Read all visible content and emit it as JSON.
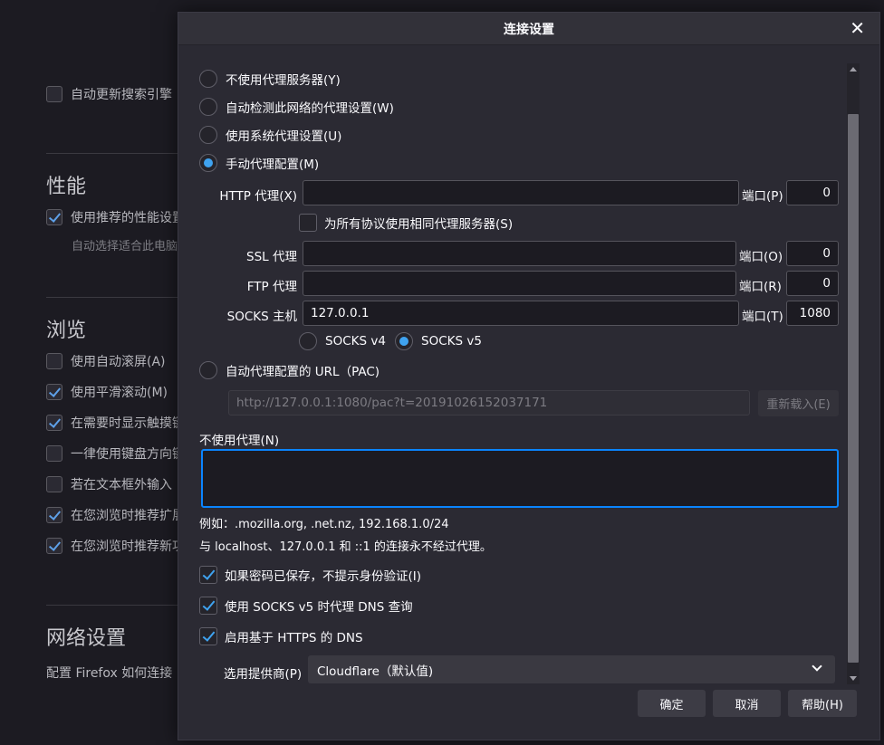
{
  "background": {
    "items": [
      {
        "label": "自动更新搜索引擎",
        "checked": false
      },
      {
        "label": "使用推荐的性能设置",
        "checked": true
      },
      {
        "label": "使用自动滚屏(A)",
        "checked": false
      },
      {
        "label": "使用平滑滚动(M)",
        "checked": true
      },
      {
        "label": "在需要时显示触摸键盘",
        "checked": true
      },
      {
        "label": "一律使用键盘方向键",
        "checked": false
      },
      {
        "label": "若在文本框外输入",
        "checked": false
      },
      {
        "label": "在您浏览时推荐扩展",
        "checked": true
      },
      {
        "label": "在您浏览时推荐新功能",
        "checked": true
      }
    ],
    "perf_sub": "自动选择适合此电脑",
    "sections": {
      "performance": "性能",
      "browsing": "浏览",
      "network": "网络设置"
    },
    "network_desc": "配置 Firefox 如何连接"
  },
  "dialog": {
    "title": "连接设置",
    "close_glyph": "✕",
    "proxy_options": {
      "none": "不使用代理服务器(Y)",
      "auto_detect": "自动检测此网络的代理设置(W)",
      "system": "使用系统代理设置(U)",
      "manual": "手动代理配置(M)",
      "pac": "自动代理配置的 URL（PAC)"
    },
    "http": {
      "label": "HTTP 代理(X)",
      "value": "",
      "port_label": "端口(P)",
      "port": "0"
    },
    "same_proxy": "为所有协议使用相同代理服务器(S)",
    "ssl": {
      "label": "SSL 代理",
      "value": "",
      "port_label": "端口(O)",
      "port": "0"
    },
    "ftp": {
      "label": "FTP 代理",
      "value": "",
      "port_label": "端口(R)",
      "port": "0"
    },
    "socks": {
      "label": "SOCKS 主机",
      "value": "127.0.0.1",
      "port_label": "端口(T)",
      "port": "1080"
    },
    "socks_v4": "SOCKS v4",
    "socks_v5": "SOCKS v5",
    "pac_url": "http://127.0.0.1:1080/pac?t=20191026152037171",
    "reload_button": "重新载入(E)",
    "no_proxy_label": "不使用代理(N)",
    "example": "例如：.mozilla.org, .net.nz, 192.168.1.0/24",
    "localhost_note": "与 localhost、127.0.0.1 和 ::1 的连接永不经过代理。",
    "no_auth_prompt": "如果密码已保存，不提示身份验证(I)",
    "socks_dns": "使用 SOCKS v5 时代理 DNS 查询",
    "https_dns": "启用基于 HTTPS 的 DNS",
    "provider_label": "选用提供商(P)",
    "provider_value": "Cloudflare（默认值)",
    "ok": "确定",
    "cancel": "取消",
    "help": "帮助(H)"
  }
}
